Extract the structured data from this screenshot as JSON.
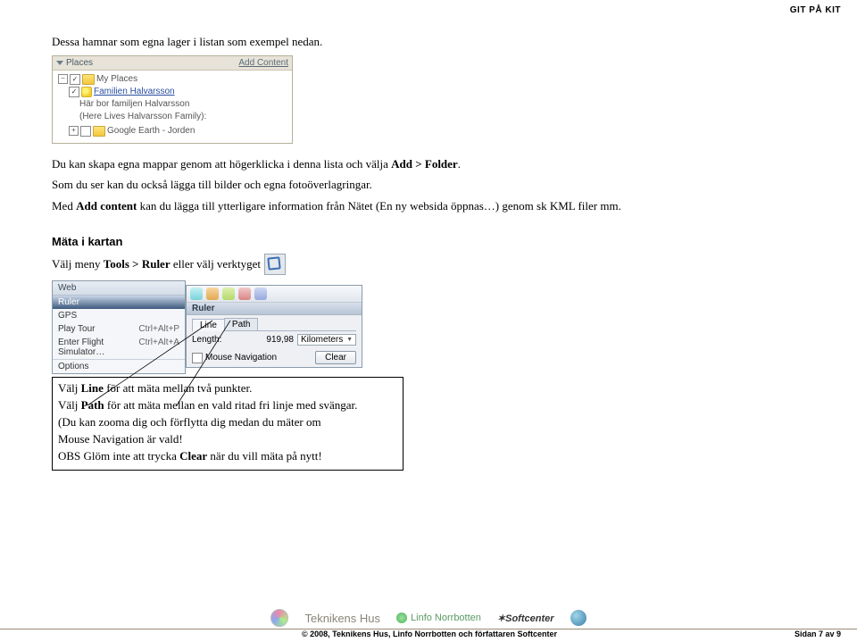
{
  "header": {
    "right": "GIT PÅ KIT"
  },
  "intro": "Dessa hamnar som egna lager i listan som exempel nedan.",
  "places": {
    "title": "Places",
    "add_content": "Add Content",
    "my_places": "My Places",
    "familien": "Familien Halvarsson",
    "desc1": "Här bor familjen Halvarsson",
    "desc2": "(Here Lives Halvarsson Family):",
    "jorden": "Google Earth - Jorden"
  },
  "para2": {
    "l1a": "Du kan skapa egna mappar genom att högerklicka i denna lista och välja ",
    "l1b": "Add > Folder",
    "l1c": ".",
    "l2": "Som du ser kan du också lägga till bilder och egna fotoöverlagringar.",
    "l3a": "Med ",
    "l3b": "Add content",
    "l3c": " kan du lägga till ytterligare information från Nätet (En ny websida öppnas…) genom sk KML filer mm."
  },
  "section": "Mäta i kartan",
  "ruler_line": {
    "a": "Välj meny ",
    "b": "Tools > Ruler",
    "c": " eller välj verktyget"
  },
  "tools": {
    "bar": "Web",
    "ruler": "Ruler",
    "gps": "GPS",
    "play": "Play Tour",
    "play_sc": "Ctrl+Alt+P",
    "efs": "Enter Flight Simulator…",
    "efs_sc": "Ctrl+Alt+A",
    "options": "Options"
  },
  "dialog": {
    "title": "Ruler",
    "tab_line": "Line",
    "tab_path": "Path",
    "length": "Length:",
    "length_val": "919,98",
    "unit": "Kilometers",
    "mouse_nav": "Mouse Navigation",
    "clear": "Clear"
  },
  "instructions": {
    "l1a": "Välj ",
    "l1b": "Line",
    "l1c": " för att mäta mellan två punkter.",
    "l2a": "Välj ",
    "l2b": "Path",
    "l2c": " för att mäta mellan en vald ritad fri linje med svängar.",
    "l3": "(Du kan zooma dig och förflytta dig medan du mäter om",
    "l4": "Mouse Navigation är vald!",
    "l5a": "OBS Glöm inte att trycka ",
    "l5b": "Clear",
    "l5c": " när du vill mäta på nytt!"
  },
  "footer": {
    "logos": {
      "teknikens": "Teknikens Hus",
      "linfo": "Linfo Norrbotten",
      "soft": "Softcenter"
    },
    "copyright": "© 2008, Teknikens Hus, Linfo Norrbotten och författaren Softcenter",
    "page": "Sidan 7 av 9"
  }
}
